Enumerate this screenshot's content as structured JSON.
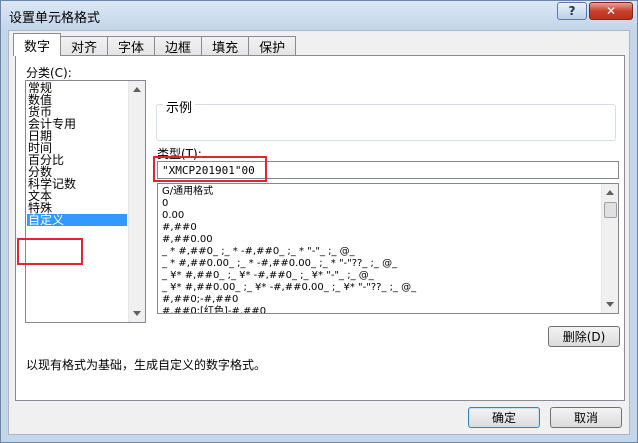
{
  "window": {
    "title": "设置单元格格式",
    "help": "?",
    "close": "✕"
  },
  "tabs": [
    {
      "label": "数字",
      "active": true
    },
    {
      "label": "对齐"
    },
    {
      "label": "字体"
    },
    {
      "label": "边框"
    },
    {
      "label": "填充"
    },
    {
      "label": "保护"
    }
  ],
  "category": {
    "label": "分类(C):",
    "items": [
      "常规",
      "数值",
      "货币",
      "会计专用",
      "日期",
      "时间",
      "百分比",
      "分数",
      "科学记数",
      "文本",
      "特殊",
      "自定义"
    ],
    "selected_index": 11
  },
  "sample": {
    "label": "示例"
  },
  "type": {
    "label": "类型(T):",
    "value": "\"XMCP201901\"00"
  },
  "formats": [
    "G/通用格式",
    "0",
    "0.00",
    "#,##0",
    "#,##0.00",
    "_ * #,##0_ ;_ * -#,##0_ ;_ * \"-\"_ ;_ @_",
    "_ * #,##0.00_ ;_ * -#,##0.00_ ;_ * \"-\"??_ ;_ @_",
    "_ ¥* #,##0_ ;_ ¥* -#,##0_ ;_ ¥* \"-\"_ ;_ @_",
    "_ ¥* #,##0.00_ ;_ ¥* -#,##0.00_ ;_ ¥* \"-\"??_ ;_ @_",
    "#,##0;-#,##0",
    "#,##0;[红色]-#,##0"
  ],
  "delete_button": "删除(D)",
  "description": "以现有格式为基础，生成自定义的数字格式。",
  "ok_button": "确定",
  "cancel_button": "取消",
  "colors": {
    "selection": "#3399ff",
    "highlight": "#e3262e",
    "close": "#c8412c"
  }
}
